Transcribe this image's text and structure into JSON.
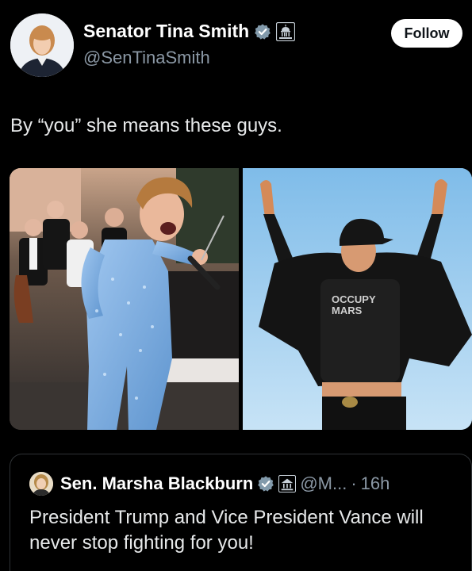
{
  "author": {
    "display_name": "Senator Tina Smith",
    "handle": "@SenTinaSmith",
    "verified": true
  },
  "actions": {
    "follow_label": "Follow"
  },
  "tweet": {
    "text": "By “you” she means these guys."
  },
  "quoted_tweet": {
    "display_name": "Sen. Marsha Blackburn",
    "handle": "@M...",
    "separator": "·",
    "time": "16h",
    "text": "President Trump and Vice President Vance will never stop fighting for you!"
  },
  "media": {
    "photo_right_shirt_text_line1": "OCCUPY",
    "photo_right_shirt_text_line2": "MARS"
  },
  "colors": {
    "verified": "#829aab",
    "background": "#000000",
    "muted": "#8b98a5"
  }
}
